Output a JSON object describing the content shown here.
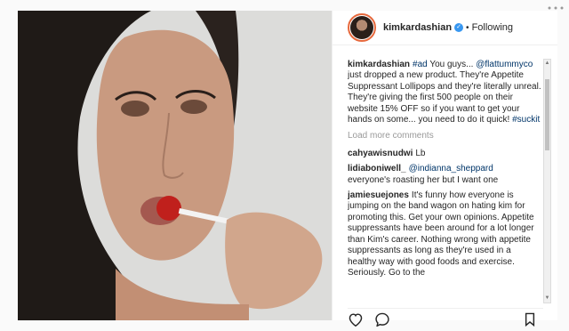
{
  "post": {
    "author": "kimkardashian",
    "follow_state": "Following",
    "separator": "•",
    "verified_glyph": "✓",
    "caption": {
      "user": "kimkardashian",
      "hashtag_ad": "#ad",
      "text1": " You guys... ",
      "mention": "@flattummyco",
      "text2": " just dropped a new product. They're Appetite Suppressant Lollipops and they're literally unreal. They're giving the first 500 people on their website 15% OFF so if you want to get your hands on some... you need to do it quick! ",
      "hashtag_suckit": "#suckit"
    },
    "load_more": "Load more comments",
    "comments": [
      {
        "user": "cahyawisnudwi",
        "text": "Lb"
      },
      {
        "user": "lidiaboniwell_",
        "mention": "@indianna_sheppard",
        "text": "everyone's roasting her but I want one"
      },
      {
        "user": "jamiesuejones",
        "text": "It's funny how everyone is jumping on the band wagon on hating kim for promoting this. Get your own opinions. Appetite suppressants have been around for a lot longer than Kim's career. Nothing wrong with appetite suppressants as long as they're used in a healthy way with good foods and exercise. Seriously. Go to the"
      }
    ]
  },
  "icons": {
    "like": "heart-icon",
    "comment": "comment-icon",
    "save": "bookmark-icon",
    "more": "more-icon"
  },
  "colors": {
    "link": "#003569",
    "verified": "#3897f0",
    "muted": "#999999"
  }
}
